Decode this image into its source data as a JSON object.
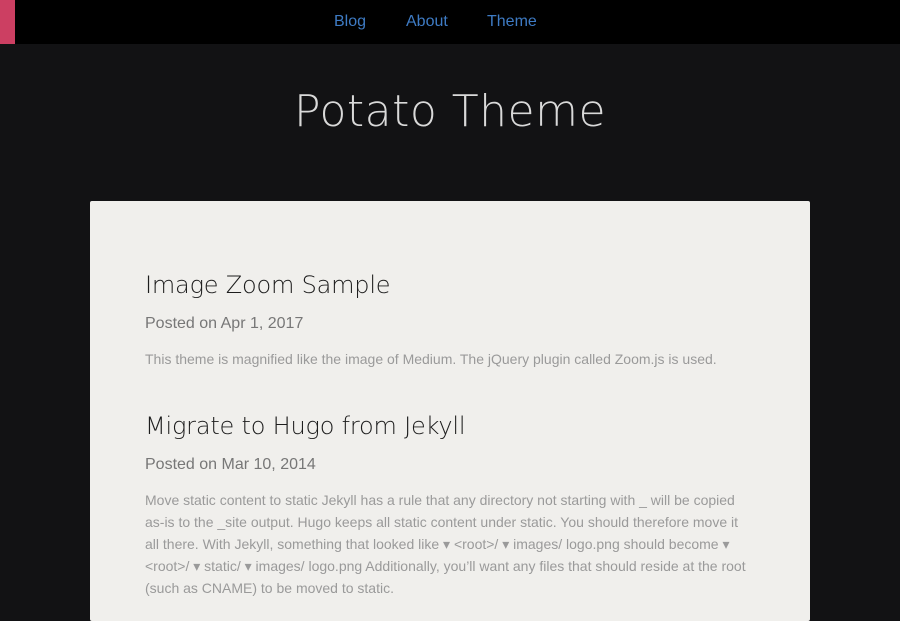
{
  "nav": {
    "items": [
      {
        "label": "Blog"
      },
      {
        "label": "About"
      },
      {
        "label": "Theme"
      }
    ]
  },
  "colors": {
    "background": "#121214",
    "topbar": "#000000",
    "accent": "#cc3f62",
    "link": "#3e7bc4",
    "card": "#f0efec"
  },
  "site": {
    "title": "Potato Theme"
  },
  "posts": [
    {
      "title": "Image Zoom Sample",
      "meta": "Posted on Apr 1, 2017",
      "excerpt": "This theme is magnified like the image of Medium. The jQuery plugin called Zoom.js is used."
    },
    {
      "title": "Migrate to Hugo from Jekyll",
      "meta": "Posted on Mar 10, 2014",
      "excerpt": "Move static content to static Jekyll has a rule that any directory not starting with _ will be copied as-is to the _site output. Hugo keeps all static content under static. You should therefore move it all there. With Jekyll, something that looked like ▾ <root>/ ▾ images/ logo.png should become ▾ <root>/ ▾ static/ ▾ images/ logo.png Additionally, you’ll want any files that should reside at the root (such as CNAME) to be moved to static."
    }
  ]
}
